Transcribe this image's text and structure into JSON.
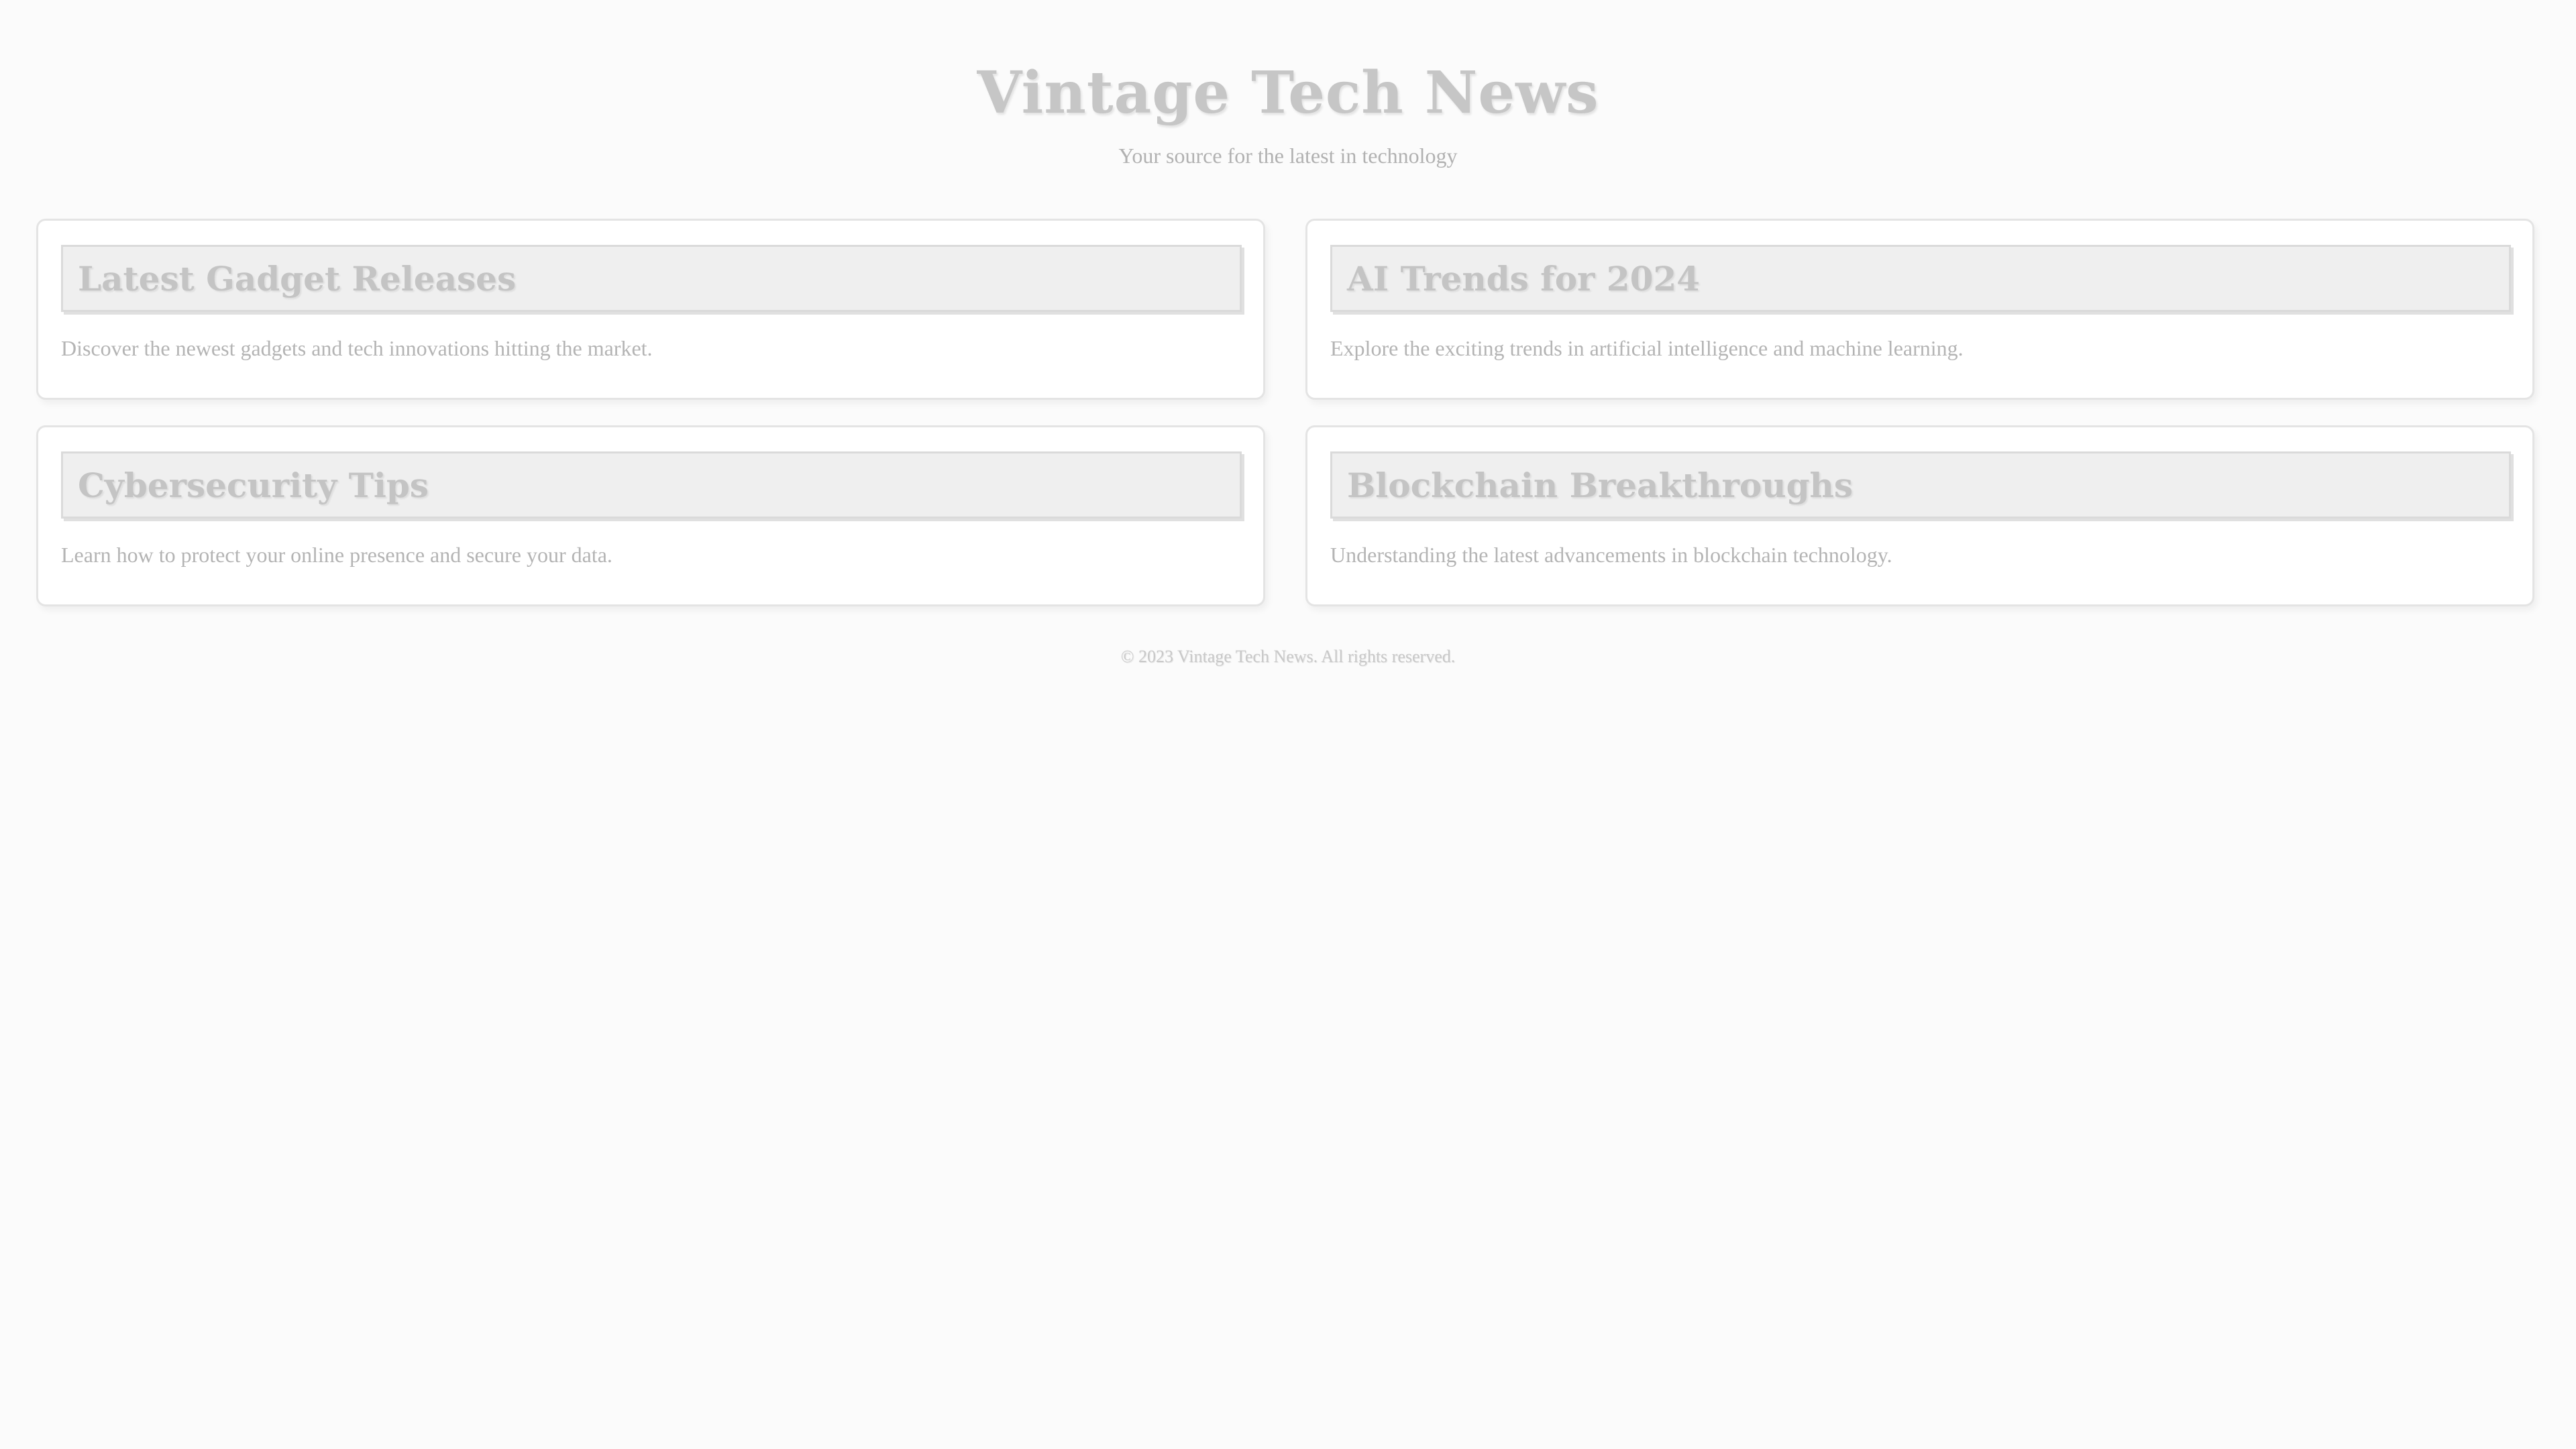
{
  "header": {
    "title": "Vintage Tech News",
    "tagline": "Your source for the latest in technology"
  },
  "articles": [
    {
      "title": "Latest Gadget Releases",
      "summary": "Discover the newest gadgets and tech innovations hitting the market."
    },
    {
      "title": "AI Trends for 2024",
      "summary": "Explore the exciting trends in artificial intelligence and machine learning."
    },
    {
      "title": "Cybersecurity Tips",
      "summary": "Learn how to protect your online presence and secure your data."
    },
    {
      "title": "Blockchain Breakthroughs",
      "summary": "Understanding the latest advancements in blockchain technology."
    }
  ],
  "footer": {
    "copyright": "© 2023 Vintage Tech News. All rights reserved."
  },
  "colors": {
    "background": "#fbfbfb",
    "card_background": "#ffffff",
    "card_header_background": "#efefef",
    "title_text": "#c6c6c6",
    "body_text": "#b4b4b4"
  }
}
